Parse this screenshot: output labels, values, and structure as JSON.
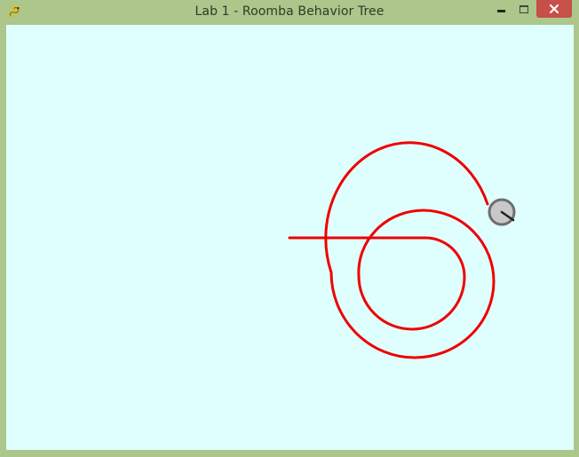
{
  "window": {
    "title": "Lab 1 - Roomba Behavior Tree",
    "app_icon": "pygame-snake-icon",
    "controls": {
      "minimize_icon": "minimize-icon",
      "maximize_icon": "maximize-icon",
      "close_icon": "close-icon"
    }
  },
  "canvas": {
    "background_color": "#dfffff",
    "path_color": "#ee0000",
    "robot_fill_color": "#c8c8c8",
    "robot_outline_color": "#6e6e6e",
    "robot_heading_color": "#222222"
  }
}
